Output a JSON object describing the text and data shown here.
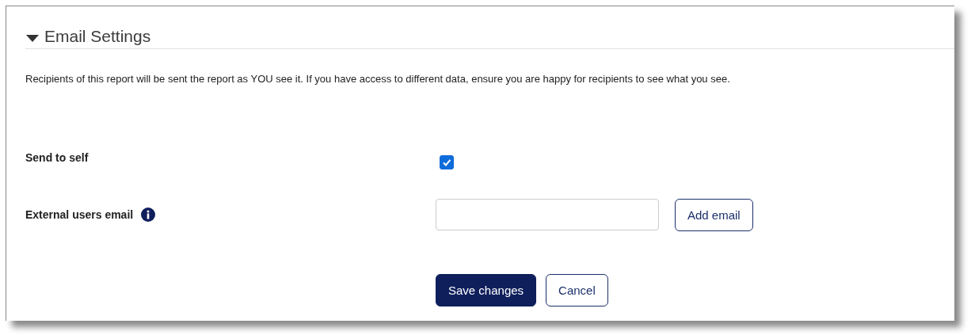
{
  "section": {
    "title": "Email Settings",
    "expanded": true
  },
  "notice": "Recipients of this report will be sent the report as YOU see it. If you have access to different data, ensure you are happy for recipients to see what you see.",
  "fields": [
    {
      "kind": "checkbox",
      "label": "Send to self",
      "checked": true
    },
    {
      "kind": "email",
      "label": "External users email",
      "info": true,
      "button": "Add email"
    }
  ],
  "actions": [
    {
      "label": "Save changes",
      "primary": true
    },
    {
      "label": "Cancel",
      "primary": false
    }
  ]
}
